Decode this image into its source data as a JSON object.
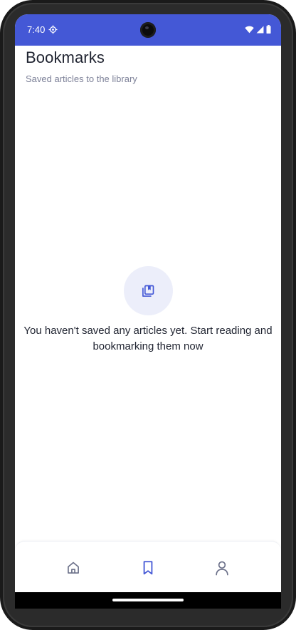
{
  "status_bar": {
    "time": "7:40",
    "background": "#4458d6",
    "icons": [
      "gear-icon",
      "wifi-icon",
      "signal-icon",
      "battery-icon"
    ]
  },
  "header": {
    "title": "Bookmarks",
    "subtitle": "Saved articles to the library"
  },
  "empty_state": {
    "icon": "bookmark-library-icon",
    "message": "You haven't saved any articles yet. Start reading and bookmarking them now"
  },
  "bottom_nav": {
    "items": [
      {
        "id": "home",
        "icon": "home-icon",
        "active": false
      },
      {
        "id": "bookmarks",
        "icon": "bookmark-icon",
        "active": true
      },
      {
        "id": "profile",
        "icon": "user-icon",
        "active": false
      }
    ],
    "active_color": "#4458d6",
    "inactive_color": "#6b7089"
  }
}
